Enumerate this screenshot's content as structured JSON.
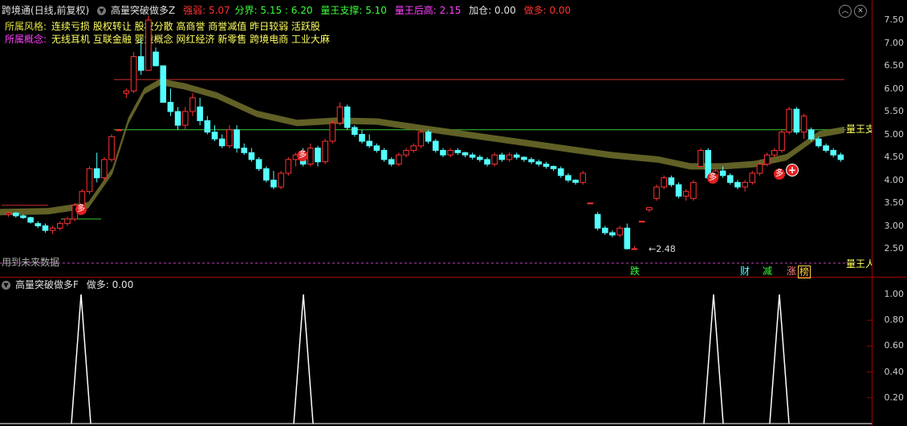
{
  "header": {
    "stock_name": "跨境通",
    "period": "(日线,前复权)",
    "indicator": "高量突破做多Z",
    "strength_label": "强弱",
    "strength_value": "5.07",
    "boundary_label": "分界",
    "boundary_value": "5.15 : 6.20",
    "support_label": "量王支撑",
    "support_value": "5.10",
    "high_label": "量王后高",
    "high_value": "2.15",
    "add_label": "加仓",
    "add_value": "0.00",
    "long_label": "做多",
    "long_value": "0.00"
  },
  "info": {
    "style_label": "所属风格:",
    "style_value": "连续亏损 股权转让 股权分散 高商誉 商誉减值 昨日较弱 活跃股",
    "concept_label": "所属概念:",
    "concept_value": "无线耳机 互联金融 婴童概念 网红经济 新零售 跨境电商 工业大麻"
  },
  "markers": {
    "long_marker": "多",
    "low_price": "2.48",
    "future_data": "用到未来数据",
    "volume_king_right": "量王支",
    "volume_king_right2": "量王人",
    "tag_die": "跌",
    "tag_cai": "财",
    "tag_jian": "减",
    "tag_zhang": "涨",
    "tag_bang": "榜"
  },
  "lower": {
    "indicator": "高量突破做多F",
    "long_label": "做多",
    "long_value": "0.00"
  },
  "axes": {
    "upper_ticks": [
      "7.50",
      "7.00",
      "6.50",
      "6.00",
      "5.50",
      "5.00",
      "4.50",
      "4.00",
      "3.50",
      "3.00",
      "2.50"
    ],
    "lower_ticks": [
      "1.00",
      "0.80",
      "0.60",
      "0.40",
      "0.20"
    ]
  },
  "colors": {
    "up": "#ff3232",
    "down": "#54ffff",
    "ma_band": "#6b6a2a",
    "level_red": "#c83030",
    "level_green": "#39c839",
    "future_line": "#c040c0"
  },
  "chart_data": {
    "type": "candlestick",
    "price_range": [
      2.15,
      7.75
    ],
    "candles": [
      [
        3.25,
        3.3,
        3.2,
        3.28
      ],
      [
        3.28,
        3.3,
        3.18,
        3.22
      ],
      [
        3.22,
        3.25,
        3.15,
        3.18
      ],
      [
        3.18,
        3.2,
        3.05,
        3.08
      ],
      [
        3.05,
        3.1,
        2.95,
        3.0
      ],
      [
        3.0,
        3.05,
        2.85,
        2.9
      ],
      [
        2.9,
        3.0,
        2.82,
        2.95
      ],
      [
        2.95,
        3.1,
        2.9,
        3.05
      ],
      [
        3.05,
        3.2,
        3.0,
        3.15
      ],
      [
        3.15,
        3.5,
        3.1,
        3.45
      ],
      [
        3.45,
        3.8,
        3.4,
        3.75
      ],
      [
        3.75,
        4.3,
        3.7,
        4.25
      ],
      [
        4.25,
        4.6,
        3.95,
        4.05
      ],
      [
        4.05,
        4.5,
        4.0,
        4.45
      ],
      [
        4.45,
        5.0,
        4.4,
        4.95
      ],
      [
        5.1,
        5.12,
        5.1,
        5.1
      ],
      [
        5.9,
        6.0,
        5.8,
        5.95
      ],
      [
        5.95,
        6.8,
        5.9,
        6.7
      ],
      [
        6.7,
        7.1,
        6.3,
        6.4
      ],
      [
        6.4,
        7.6,
        6.4,
        7.5
      ],
      [
        6.8,
        6.9,
        6.5,
        6.5
      ],
      [
        6.5,
        6.4,
        5.8,
        5.7
      ],
      [
        5.7,
        6.0,
        5.4,
        5.5
      ],
      [
        5.5,
        5.6,
        5.1,
        5.2
      ],
      [
        5.2,
        5.6,
        5.1,
        5.5
      ],
      [
        5.5,
        5.9,
        5.4,
        5.8
      ],
      [
        5.6,
        5.8,
        5.2,
        5.3
      ],
      [
        5.3,
        5.4,
        5.0,
        5.05
      ],
      [
        5.05,
        5.2,
        4.85,
        4.9
      ],
      [
        4.9,
        5.0,
        4.7,
        4.75
      ],
      [
        4.75,
        5.2,
        4.7,
        5.1
      ],
      [
        5.1,
        5.2,
        4.6,
        4.7
      ],
      [
        4.7,
        4.8,
        4.55,
        4.6
      ],
      [
        4.6,
        4.7,
        4.4,
        4.45
      ],
      [
        4.45,
        4.5,
        4.2,
        4.25
      ],
      [
        4.25,
        4.3,
        3.95,
        4.0
      ],
      [
        4.0,
        4.2,
        3.8,
        3.85
      ],
      [
        3.85,
        4.2,
        3.8,
        4.15
      ],
      [
        4.15,
        4.5,
        4.1,
        4.45
      ],
      [
        4.45,
        4.6,
        4.3,
        4.55
      ],
      [
        4.55,
        4.7,
        4.3,
        4.35
      ],
      [
        4.35,
        4.8,
        4.3,
        4.7
      ],
      [
        4.7,
        4.75,
        4.3,
        4.4
      ],
      [
        4.4,
        4.9,
        4.35,
        4.85
      ],
      [
        4.85,
        5.3,
        4.8,
        5.25
      ],
      [
        5.25,
        5.7,
        5.2,
        5.6
      ],
      [
        5.6,
        5.65,
        5.1,
        5.15
      ],
      [
        5.15,
        5.2,
        4.95,
        5.0
      ],
      [
        5.0,
        5.1,
        4.8,
        4.85
      ],
      [
        4.85,
        5.0,
        4.7,
        4.75
      ],
      [
        4.75,
        4.8,
        4.6,
        4.65
      ],
      [
        4.65,
        4.7,
        4.4,
        4.45
      ],
      [
        4.45,
        4.5,
        4.3,
        4.35
      ],
      [
        4.35,
        4.6,
        4.3,
        4.55
      ],
      [
        4.55,
        4.7,
        4.5,
        4.65
      ],
      [
        4.65,
        4.8,
        4.6,
        4.75
      ],
      [
        4.75,
        5.1,
        4.7,
        5.05
      ],
      [
        5.05,
        5.1,
        4.8,
        4.85
      ],
      [
        4.85,
        4.9,
        4.6,
        4.65
      ],
      [
        4.65,
        4.7,
        4.5,
        4.55
      ],
      [
        4.55,
        4.7,
        4.5,
        4.65
      ],
      [
        4.65,
        4.7,
        4.55,
        4.6
      ],
      [
        4.6,
        4.62,
        4.5,
        4.55
      ],
      [
        4.55,
        4.6,
        4.45,
        4.5
      ],
      [
        4.5,
        4.55,
        4.4,
        4.45
      ],
      [
        4.45,
        4.5,
        4.3,
        4.35
      ],
      [
        4.35,
        4.6,
        4.3,
        4.55
      ],
      [
        4.55,
        4.6,
        4.4,
        4.45
      ],
      [
        4.45,
        4.6,
        4.4,
        4.55
      ],
      [
        4.55,
        4.6,
        4.45,
        4.5
      ],
      [
        4.5,
        4.52,
        4.4,
        4.45
      ],
      [
        4.45,
        4.5,
        4.35,
        4.4
      ],
      [
        4.4,
        4.45,
        4.3,
        4.35
      ],
      [
        4.35,
        4.4,
        4.25,
        4.3
      ],
      [
        4.3,
        4.32,
        4.2,
        4.25
      ],
      [
        4.25,
        4.3,
        4.05,
        4.1
      ],
      [
        4.1,
        4.15,
        3.95,
        4.0
      ],
      [
        4.0,
        4.02,
        3.9,
        3.95
      ],
      [
        3.95,
        4.2,
        3.9,
        4.15
      ],
      [
        3.5,
        3.5,
        3.5,
        3.5
      ],
      [
        3.25,
        3.3,
        2.9,
        2.95
      ],
      [
        2.95,
        3.0,
        2.8,
        2.85
      ],
      [
        2.85,
        2.9,
        2.75,
        2.8
      ],
      [
        2.8,
        3.0,
        2.75,
        2.95
      ],
      [
        2.95,
        3.05,
        2.48,
        2.5
      ],
      [
        2.5,
        2.55,
        2.48,
        2.5
      ],
      [
        3.1,
        3.1,
        3.1,
        3.1
      ],
      [
        3.35,
        3.4,
        3.3,
        3.4
      ],
      [
        3.6,
        3.9,
        3.55,
        3.85
      ],
      [
        3.85,
        4.1,
        3.8,
        4.05
      ],
      [
        4.05,
        4.1,
        3.85,
        3.9
      ],
      [
        3.9,
        3.95,
        3.6,
        3.65
      ],
      [
        3.65,
        3.8,
        3.55,
        3.75
      ],
      [
        3.6,
        4.0,
        3.55,
        3.95
      ],
      [
        4.3,
        4.7,
        4.3,
        4.65
      ],
      [
        4.65,
        4.7,
        4.0,
        4.05
      ],
      [
        4.05,
        4.25,
        4.0,
        4.2
      ],
      [
        4.2,
        4.3,
        4.05,
        4.1
      ],
      [
        4.1,
        4.15,
        3.9,
        3.95
      ],
      [
        3.95,
        4.0,
        3.8,
        3.85
      ],
      [
        3.85,
        4.0,
        3.75,
        3.95
      ],
      [
        3.95,
        4.2,
        3.9,
        4.15
      ],
      [
        4.15,
        4.4,
        4.1,
        4.35
      ],
      [
        4.35,
        4.6,
        4.3,
        4.55
      ],
      [
        4.55,
        4.7,
        4.5,
        4.65
      ],
      [
        4.65,
        5.1,
        4.6,
        5.05
      ],
      [
        5.05,
        5.6,
        5.0,
        5.55
      ],
      [
        5.55,
        5.6,
        5.0,
        5.05
      ],
      [
        5.05,
        5.45,
        4.9,
        5.4
      ],
      [
        5.1,
        5.15,
        4.85,
        4.9
      ],
      [
        4.9,
        4.95,
        4.7,
        4.75
      ],
      [
        4.75,
        4.8,
        4.6,
        4.65
      ],
      [
        4.65,
        4.7,
        4.5,
        4.55
      ],
      [
        4.55,
        4.6,
        4.4,
        4.45
      ]
    ],
    "levels": [
      6.2,
      5.1,
      3.45,
      3.15,
      2.15
    ],
    "signal_peaks": [
      1.0,
      1.0,
      1.0,
      1.0
    ],
    "signal_range": [
      0,
      1.1
    ]
  }
}
